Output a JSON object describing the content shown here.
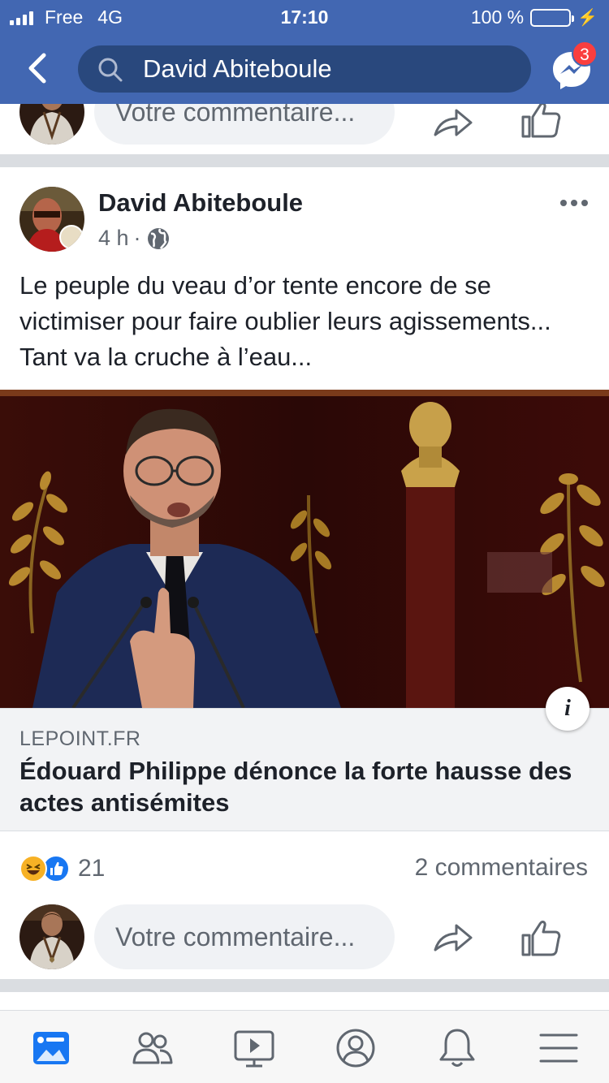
{
  "status_bar": {
    "carrier": "Free",
    "network": "4G",
    "time": "17:10",
    "battery": "100 %"
  },
  "header": {
    "search_value": "David Abiteboule",
    "messenger_badge": "3"
  },
  "previous_post": {
    "comment_placeholder": "Votre commentaire..."
  },
  "post": {
    "author": "David Abiteboule",
    "time": "4 h",
    "separator": "·",
    "text": "Le peuple du veau d’or tente encore de se victimiser pour faire oublier leurs agissements... Tant va la cruche à l’eau...",
    "link": {
      "domain": "LEPOINT.FR",
      "title": "Édouard Philippe dénonce la forte hausse des actes antisémites",
      "info_label": "i"
    },
    "reactions": {
      "types": [
        "haha",
        "like"
      ],
      "count": "21"
    },
    "comments_count": "2 commentaires",
    "comment_placeholder": "Votre commentaire..."
  },
  "tabbar": {
    "items": [
      "news-feed",
      "friends",
      "watch",
      "profile",
      "notifications",
      "menu"
    ],
    "active": "news-feed"
  },
  "colors": {
    "brand": "#4267b2",
    "search_bg": "#29487d",
    "badge": "#fa3e3e",
    "active_tab": "#1877f2"
  }
}
